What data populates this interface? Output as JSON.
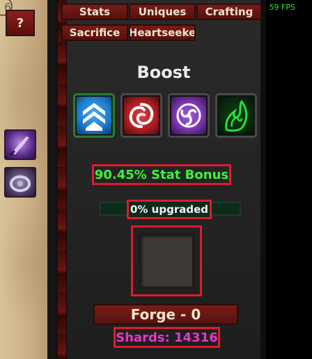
{
  "tabs": {
    "row1": [
      "Stats",
      "Uniques",
      "Crafting"
    ],
    "row2": [
      "Sacrifice",
      "Heartseeke"
    ]
  },
  "fps": "59 FPS",
  "help_label": "?",
  "parchment_marker": "6",
  "boost": {
    "title": "Boost",
    "options": [
      {
        "icon": "chevron-up-icon",
        "selected": true,
        "color": "#1f7fd1"
      },
      {
        "icon": "swirl-icon",
        "selected": false,
        "color": "#b01e22"
      },
      {
        "icon": "triskelion-icon",
        "selected": false,
        "color": "#7b36b0"
      },
      {
        "icon": "flame-vortex-icon",
        "selected": false,
        "color": "#27c23a"
      }
    ]
  },
  "stat_bonus": "90.45% Stat Bonus",
  "upgrade": {
    "label": "0% upgraded",
    "progress": 0
  },
  "forge": {
    "label": "Forge - 0"
  },
  "shards": "Shards: 14316",
  "colors": {
    "highlight_border": "#e01b2c",
    "stat_bonus_text": "#3ff23a",
    "shards_text": "#e33ac4",
    "fps_text": "#36e23a"
  }
}
